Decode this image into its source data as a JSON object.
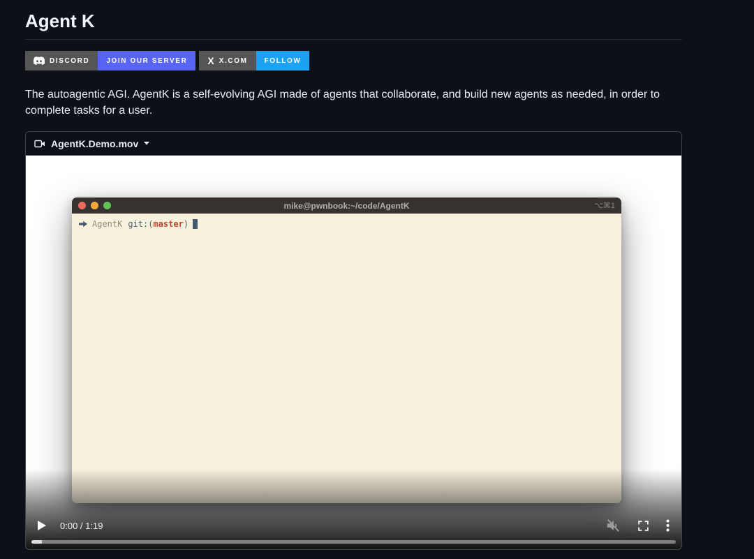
{
  "page": {
    "title": "Agent K"
  },
  "badges": {
    "discord": {
      "label": "DISCORD",
      "action": "JOIN OUR SERVER"
    },
    "x": {
      "label": "X.COM",
      "action": "FOLLOW",
      "x_glyph": "X"
    }
  },
  "description": "The autoagentic AGI. AgentK is a self-evolving AGI made of agents that collaborate, and build new agents as needed, in order to complete tasks for a user.",
  "video": {
    "filename": "AgentK.Demo.mov",
    "controls": {
      "time": "0:00 / 1:19"
    },
    "terminal": {
      "title": "mike@pwnbook:~/code/AgentK",
      "shortcut": "⌥⌘1",
      "prompt": {
        "arrow": "➜",
        "dir": "AgentK",
        "git_open": "git:(",
        "branch": "master",
        "git_close": ")"
      }
    }
  },
  "colors": {
    "page_bg": "#0d1117",
    "badge_gray": "#555555",
    "discord_blurple": "#5865F2",
    "x_follow_blue": "#1DA1F2",
    "terminal_titlebar": "#37322f",
    "terminal_bg": "#f8f1dd",
    "prompt_slate": "#44596b",
    "branch_red": "#c2462d"
  }
}
